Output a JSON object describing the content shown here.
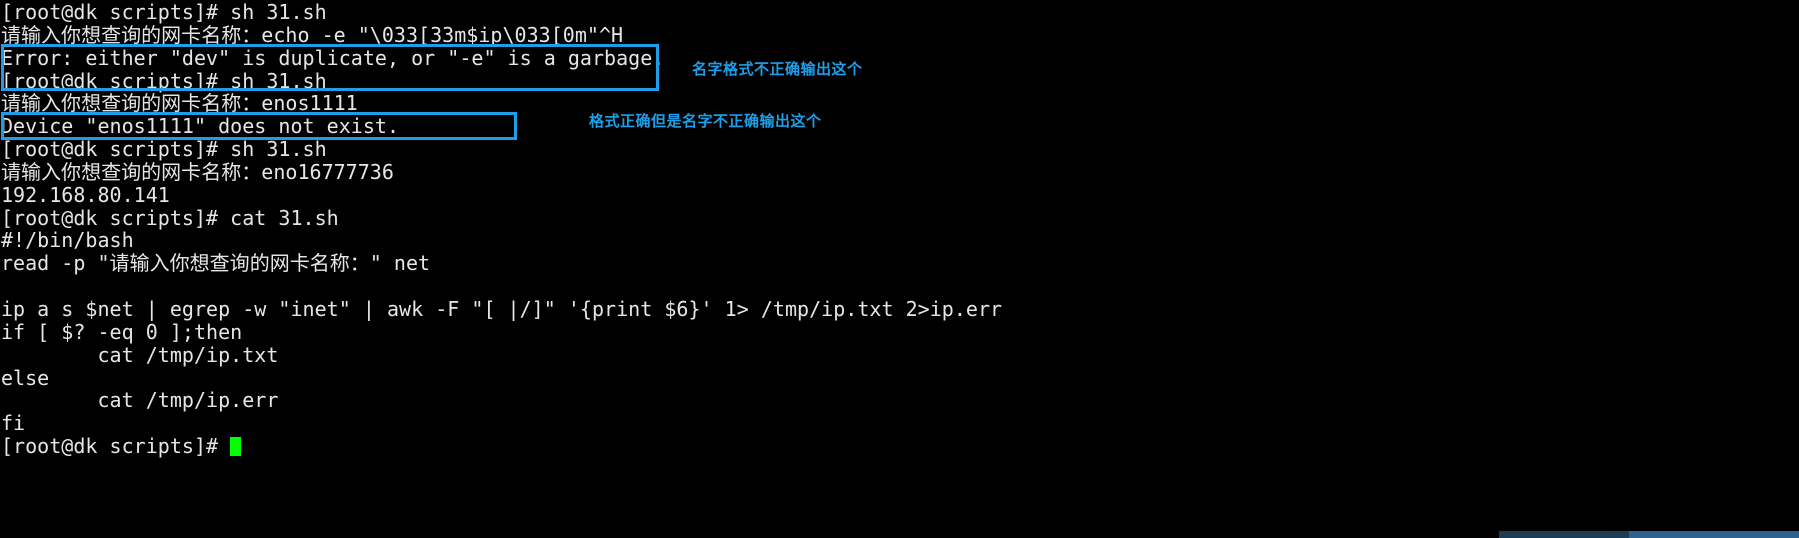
{
  "terminal": {
    "title": "root@dk:~/scripts",
    "background_color": "#000000",
    "foreground_color": "#e6e6e6",
    "cursor_color": "#00ff00",
    "annotation_color": "#1e9ee8",
    "prompt": "[root@dk scripts]# ",
    "lines": [
      "[root@dk scripts]# sh 31.sh",
      "请输入你想查询的网卡名称：echo -e \"\\033[33m$ip\\033[0m\"^H",
      "Error: either \"dev\" is duplicate, or \"-e\" is a garbage.",
      "[root@dk scripts]# sh 31.sh",
      "请输入你想查询的网卡名称：enos1111",
      "Device \"enos1111\" does not exist.",
      "[root@dk scripts]# sh 31.sh",
      "请输入你想查询的网卡名称：eno16777736",
      "192.168.80.141",
      "[root@dk scripts]# cat 31.sh",
      "#!/bin/bash",
      "read -p \"请输入你想查询的网卡名称：\" net",
      "",
      "ip a s $net | egrep -w \"inet\" | awk -F \"[ |/]\" '{print $6}' 1> /tmp/ip.txt 2>ip.err",
      "if [ $? -eq 0 ];then",
      "        cat /tmp/ip.txt",
      "else",
      "        cat /tmp/ip.err",
      "fi",
      "[root@dk scripts]# "
    ]
  },
  "annotations": {
    "labels": [
      {
        "text": "名字格式不正确输出这个"
      },
      {
        "text": "格式正确但是名字不正确输出这个"
      }
    ],
    "boxes": [
      {
        "name": "error-output-highlight"
      },
      {
        "name": "device-not-exist-highlight"
      }
    ]
  }
}
